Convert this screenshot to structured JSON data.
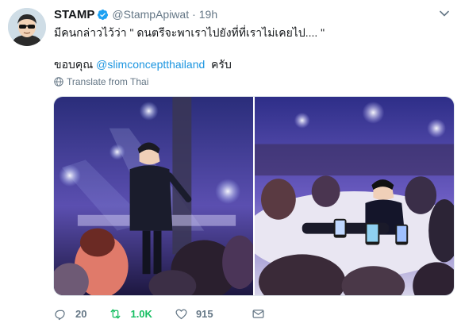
{
  "user": {
    "display_name": "STAMP",
    "handle": "@StampApiwat",
    "separator": "·",
    "time": "19h"
  },
  "tweet": {
    "line1": "มีคนกล่าวไว้ว่า \" ดนตรีจะพาเราไปยังที่ที่เราไม่เคยไป.... \"",
    "line2_prefix": "ขอบคุณ ",
    "line2_mention": "@slimconceptthailand",
    "line2_suffix": "  ครับ",
    "translate": "Translate from Thai"
  },
  "stats": {
    "replies": "20",
    "retweets": "1.0K",
    "likes": "915"
  },
  "colors": {
    "verified": "#1da1f2",
    "link": "#1b95e0",
    "retweet_active": "#17bf63",
    "secondary": "#657786"
  },
  "icons": [
    "verified-badge-icon",
    "chevron-down-icon",
    "globe-icon",
    "reply-icon",
    "retweet-icon",
    "like-icon",
    "mail-icon"
  ]
}
